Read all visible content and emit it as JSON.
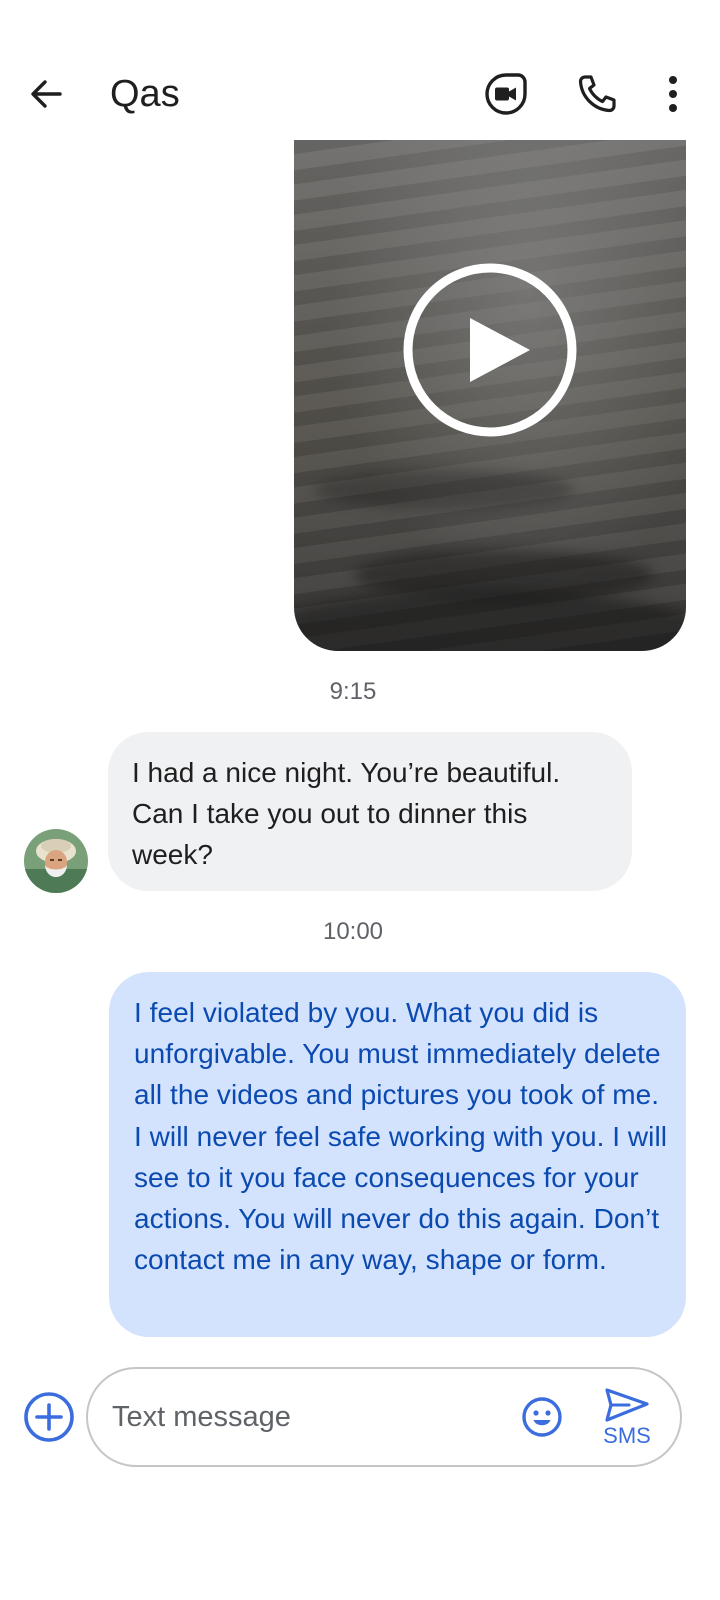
{
  "header": {
    "contact_name": "Qas",
    "back_icon": "arrow-back-icon",
    "video_icon": "video-call-icon",
    "call_icon": "phone-icon",
    "more_icon": "more-vert-icon"
  },
  "thread": {
    "video_message": {
      "icon": "play-icon"
    },
    "timestamp_1": "9:15",
    "incoming_message": {
      "text": "I had a nice night. You’re beautiful. Can I take you out to dinner this week?",
      "avatar": "contact-avatar"
    },
    "timestamp_2": "10:00",
    "outgoing_message": {
      "text": "I feel violated by you. What you did is unforgivable. You must immediately delete all the videos and pictures you took of me. I will never feel safe working with you. I will see to it you face consequences for your actions. You will never do this again. Don’t contact me in any way, shape or form."
    }
  },
  "compose": {
    "placeholder": "Text message",
    "value": "",
    "send_label": "SMS",
    "attach_icon": "add-circle-icon",
    "emoji_icon": "emoji-icon",
    "send_icon": "send-icon"
  },
  "colors": {
    "accent": "#3b6ddf",
    "incoming_bubble": "#f0f1f3",
    "outgoing_bubble": "#d3e3fd",
    "outgoing_text": "#0b4ab0"
  }
}
